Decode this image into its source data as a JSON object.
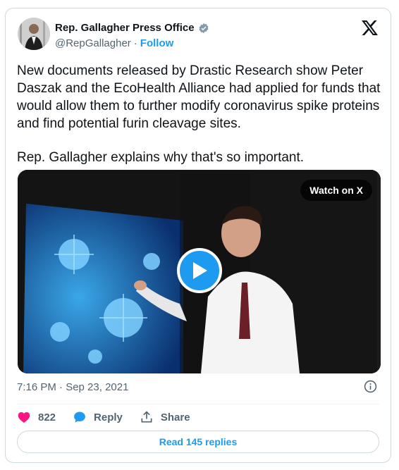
{
  "author": {
    "name": "Rep. Gallagher Press Office",
    "handle": "@RepGallagher",
    "separator": "·",
    "follow_label": "Follow"
  },
  "tweet": {
    "paragraphs": [
      "New documents released by Drastic Research show Peter Daszak and the EcoHealth Alliance had applied for funds that would allow them to further modify coronavirus spike proteins and find potential furin cleavage sites.",
      "Rep. Gallagher explains why that's so important."
    ],
    "timestamp": "7:16 PM · Sep 23, 2021"
  },
  "media": {
    "watch_label": "Watch on X"
  },
  "actions": {
    "likes": "822",
    "reply_label": "Reply",
    "share_label": "Share"
  },
  "footer": {
    "read_replies_label": "Read 145 replies"
  },
  "colors": {
    "accent": "#1d9bf0",
    "like": "#f91880",
    "text": "#0f1419",
    "muted": "#536471"
  }
}
